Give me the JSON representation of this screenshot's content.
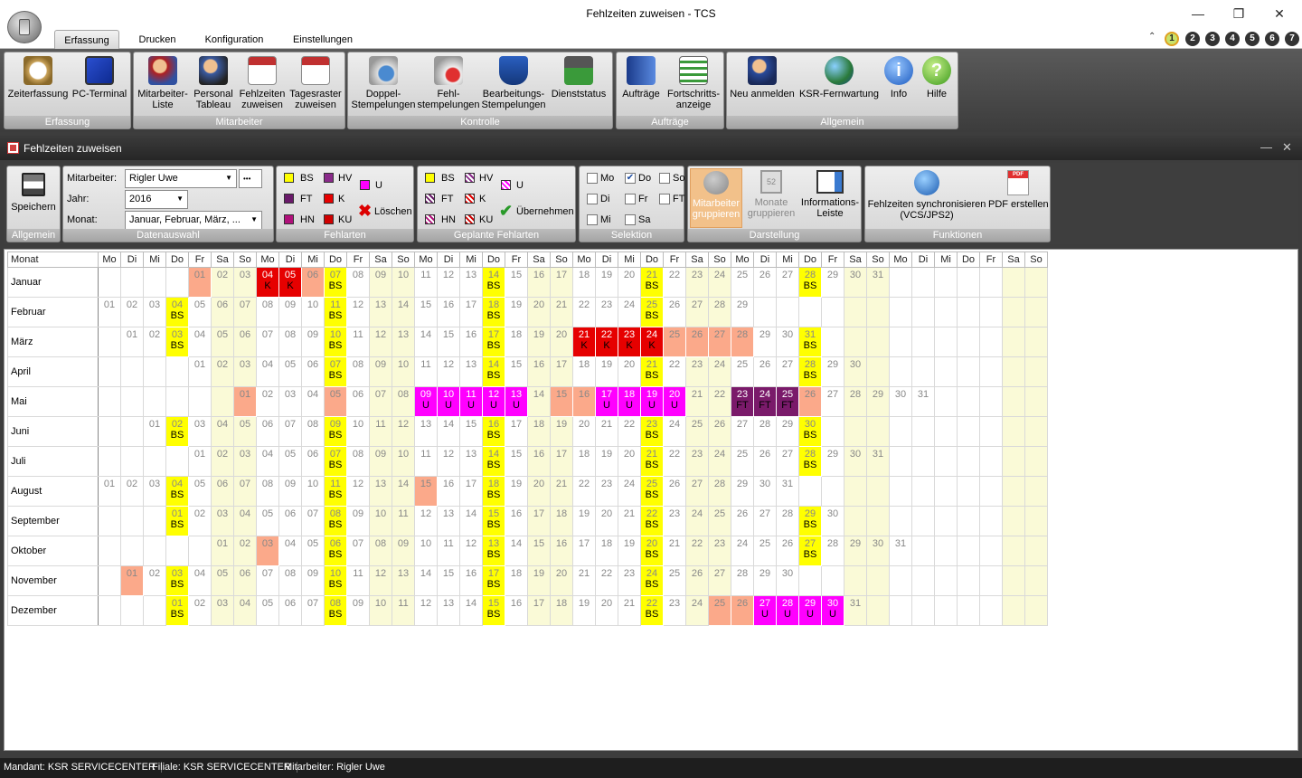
{
  "window": {
    "title": "Fehlzeiten zuweisen - TCS"
  },
  "tabs": [
    "Erfassung",
    "Drucken",
    "Konfiguration",
    "Einstellungen"
  ],
  "quick_numbers": [
    "1",
    "2",
    "3",
    "4",
    "5",
    "6",
    "7"
  ],
  "ribbon": {
    "groups": [
      {
        "label": "Erfassung",
        "buttons": [
          "Zeiterfassung",
          "PC-Terminal"
        ]
      },
      {
        "label": "Mitarbeiter",
        "buttons": [
          "Mitarbeiter-\nListe",
          "Personal\nTableau",
          "Fehlzeiten\nzuweisen",
          "Tagesraster\nzuweisen"
        ]
      },
      {
        "label": "Kontrolle",
        "buttons": [
          "Doppel-\nStempelungen",
          "Fehl-\nstempelungen",
          "Bearbeitungs-\nStempelungen",
          "Dienststatus"
        ]
      },
      {
        "label": "Aufträge",
        "buttons": [
          "Aufträge",
          "Fortschritts-\nanzeige"
        ]
      },
      {
        "label": "Allgemein",
        "buttons": [
          "Neu anmelden",
          "KSR-Fernwartung",
          "Info",
          "Hilfe"
        ]
      }
    ]
  },
  "mdi": {
    "title": "Fehlzeiten zuweisen"
  },
  "toolbar": {
    "allgemein": {
      "label": "Allgemein",
      "save": "Speichern"
    },
    "datenauswahl": {
      "label": "Datenauswahl",
      "mitarbeiter_label": "Mitarbeiter:",
      "mitarbeiter_value": "Rigler Uwe",
      "ellipsis": "•••",
      "jahr_label": "Jahr:",
      "jahr_value": "2016",
      "monat_label": "Monat:",
      "monat_value": "Januar, Februar, März, ..."
    },
    "fehlarten": {
      "label": "Fehlarten",
      "codes": [
        "BS",
        "HV",
        "U",
        "FT",
        "K",
        "HN",
        "KU"
      ],
      "delete": "Löschen"
    },
    "geplante": {
      "label": "Geplante Fehlarten",
      "codes": [
        "BS",
        "HV",
        "U",
        "FT",
        "K",
        "HN",
        "KU"
      ],
      "apply": "Übernehmen"
    },
    "selektion": {
      "label": "Selektion",
      "days": [
        {
          "d": "Mo",
          "checked": false
        },
        {
          "d": "Do",
          "checked": true
        },
        {
          "d": "So",
          "checked": false
        },
        {
          "d": "Di",
          "checked": false
        },
        {
          "d": "Fr",
          "checked": false
        },
        {
          "d": "FT",
          "checked": false
        },
        {
          "d": "Mi",
          "checked": false
        },
        {
          "d": "Sa",
          "checked": false
        }
      ]
    },
    "darstellung": {
      "label": "Darstellung",
      "buttons": [
        "Mitarbeiter\ngruppieren",
        "Monate\ngruppieren",
        "Informations-\nLeiste"
      ]
    },
    "funktionen": {
      "label": "Funktionen",
      "buttons": [
        "Fehlzeiten synchronisieren\n(VCS/JPS2)",
        "PDF erstellen"
      ]
    }
  },
  "colors": {
    "BS": "#ffff00",
    "K": "#e60000",
    "U": "#ff00ff",
    "FT": "#7a1a6a",
    "holiday": "#fba98a",
    "weekend": "#fafad7"
  },
  "calendar": {
    "header_first": "Monat",
    "weekdays": [
      "Mo",
      "Di",
      "Mi",
      "Do",
      "Fr",
      "Sa",
      "So",
      "Mo",
      "Di",
      "Mi",
      "Do",
      "Fr",
      "Sa",
      "So",
      "Mo",
      "Di",
      "Mi",
      "Do",
      "Fr",
      "Sa",
      "So",
      "Mo",
      "Di",
      "Mi",
      "Do",
      "Fr",
      "Sa",
      "So",
      "Mo",
      "Di",
      "Mi",
      "Do",
      "Fr",
      "Sa",
      "So",
      "Mo",
      "Di",
      "Mi",
      "Do",
      "Fr",
      "Sa",
      "So"
    ],
    "months": [
      {
        "name": "Januar",
        "start": 4,
        "days": 31,
        "marks": {
          "1": "H",
          "4": "K",
          "5": "K",
          "6": "H",
          "7": "BS",
          "14": "BS",
          "21": "BS",
          "28": "BS"
        }
      },
      {
        "name": "Februar",
        "start": 0,
        "days": 29,
        "marks": {
          "4": "BS",
          "11": "BS",
          "18": "BS",
          "25": "BS"
        }
      },
      {
        "name": "März",
        "start": 1,
        "days": 31,
        "marks": {
          "3": "BS",
          "10": "BS",
          "17": "BS",
          "21": "K",
          "22": "K",
          "23": "K",
          "24": "K",
          "25": "H",
          "26": "H",
          "27": "H",
          "28": "H",
          "31": "BS"
        }
      },
      {
        "name": "April",
        "start": 4,
        "days": 30,
        "marks": {
          "7": "BS",
          "14": "BS",
          "21": "BS",
          "28": "BS"
        }
      },
      {
        "name": "Mai",
        "start": 6,
        "days": 31,
        "marks": {
          "1": "H",
          "5": "H",
          "9": "U",
          "10": "U",
          "11": "U",
          "12": "U",
          "13": "U",
          "15": "H",
          "16": "H",
          "17": "U",
          "18": "U",
          "19": "U",
          "20": "U",
          "23": "FT",
          "24": "FT",
          "25": "FT",
          "26": "H"
        }
      },
      {
        "name": "Juni",
        "start": 2,
        "days": 30,
        "marks": {
          "2": "BS",
          "9": "BS",
          "16": "BS",
          "23": "BS",
          "30": "BS"
        }
      },
      {
        "name": "Juli",
        "start": 4,
        "days": 31,
        "marks": {
          "7": "BS",
          "14": "BS",
          "21": "BS",
          "28": "BS"
        }
      },
      {
        "name": "August",
        "start": 0,
        "days": 31,
        "marks": {
          "4": "BS",
          "11": "BS",
          "15": "H",
          "18": "BS",
          "25": "BS"
        }
      },
      {
        "name": "September",
        "start": 3,
        "days": 30,
        "marks": {
          "1": "BS",
          "8": "BS",
          "15": "BS",
          "22": "BS",
          "29": "BS"
        }
      },
      {
        "name": "Oktober",
        "start": 5,
        "days": 31,
        "marks": {
          "3": "H",
          "6": "BS",
          "13": "BS",
          "20": "BS",
          "27": "BS"
        }
      },
      {
        "name": "November",
        "start": 1,
        "days": 30,
        "marks": {
          "1": "H",
          "3": "BS",
          "10": "BS",
          "17": "BS",
          "24": "BS"
        }
      },
      {
        "name": "Dezember",
        "start": 3,
        "days": 31,
        "marks": {
          "1": "BS",
          "8": "BS",
          "15": "BS",
          "22": "BS",
          "25": "H",
          "26": "H",
          "27": "U",
          "28": "U",
          "29": "U",
          "30": "U"
        }
      }
    ]
  },
  "status": {
    "mandant": "Mandant: KSR SERVICECENTER",
    "filiale": "Filiale: KSR SERVICECENTER",
    "mitarbeiter": "Mitarbeiter: Rigler Uwe"
  }
}
